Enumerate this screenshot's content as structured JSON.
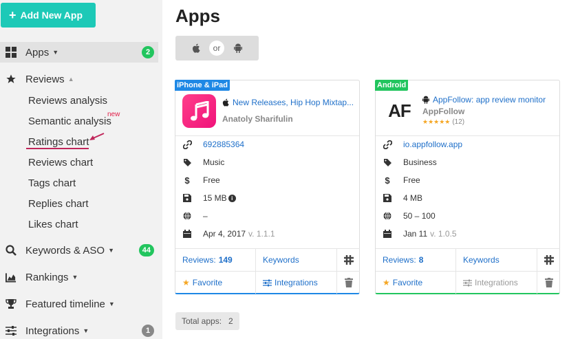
{
  "sidebar": {
    "add_button_label": "Add New App",
    "apps_label": "Apps",
    "apps_badge": "2",
    "reviews_label": "Reviews",
    "sub_items": [
      "Reviews analysis",
      "Semantic analysis",
      "Ratings chart",
      "Reviews chart",
      "Tags chart",
      "Replies chart",
      "Likes chart"
    ],
    "new_tag": "new",
    "keywords_label": "Keywords & ASO",
    "keywords_badge": "44",
    "rankings_label": "Rankings",
    "featured_label": "Featured timeline",
    "integrations_label": "Integrations",
    "integrations_badge": "1"
  },
  "main": {
    "title": "Apps",
    "toggle_or": "or",
    "total_label": "Total apps:",
    "total_value": "2"
  },
  "cards": [
    {
      "platform": "iPhone & iPad",
      "name": "New Releases, Hip Hop Mixtap...",
      "developer": "Anatoly Sharifulin",
      "id": "692885364",
      "category": "Music",
      "price": "Free",
      "size": "15 MB",
      "languages": "–",
      "date": "Apr 4, 2017",
      "version": "v. 1.1.1",
      "reviews_label": "Reviews:",
      "reviews_count": "149",
      "keywords": "Keywords",
      "favorite": "Favorite",
      "integrations": "Integrations"
    },
    {
      "platform": "Android",
      "name": "AppFollow: app review monitor",
      "developer": "AppFollow",
      "icon_text": "AF",
      "rating_count": "(12)",
      "id": "io.appfollow.app",
      "category": "Business",
      "price": "Free",
      "size": "4 MB",
      "languages": "50 – 100",
      "date": "Jan 11",
      "version": "v. 1.0.5",
      "reviews_label": "Reviews:",
      "reviews_count": "8",
      "keywords": "Keywords",
      "favorite": "Favorite",
      "integrations": "Integrations"
    }
  ],
  "colors": {
    "accent": "#1dc9b7",
    "ios": "#1e88e5",
    "android": "#22c55e",
    "link": "#1e6fc9"
  }
}
